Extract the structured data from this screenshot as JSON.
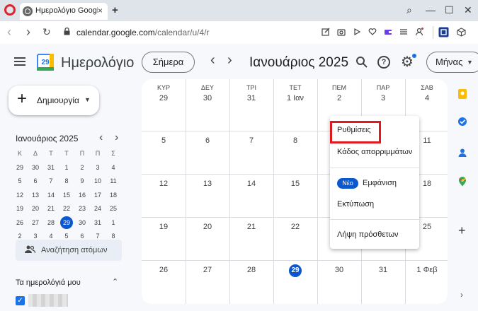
{
  "browser": {
    "tab_title": "Ημερολόγιο Google - Ιαν",
    "tab_close": "×",
    "new_tab": "+",
    "url_host": "calendar.google.com",
    "url_path": "/calendar/u/4/r",
    "controls": {
      "search": "⌕",
      "minimize": "—",
      "maximize": "☐",
      "close": "✕"
    },
    "nav": {
      "back": "‹",
      "forward": "›",
      "reload": "↻"
    }
  },
  "header": {
    "app_title": "Ημερολόγιο",
    "logo_day": "29",
    "today_button": "Σήμερα",
    "prev": "‹",
    "next": "›",
    "month_title": "Ιανουάριος 2025",
    "help": "?",
    "gear": "⚙",
    "view_button": "Μήνας",
    "view_caret": "▼"
  },
  "sidebar": {
    "create_label": "Δημιουργία",
    "create_plus": "+",
    "create_caret": "▼",
    "mini_title": "Ιανουάριος 2025",
    "mini_prev": "‹",
    "mini_next": "›",
    "weekday_heads": [
      "Κ",
      "Δ",
      "Τ",
      "Τ",
      "Π",
      "Π",
      "Σ"
    ],
    "mini_weeks": [
      [
        "29",
        "30",
        "31",
        "1",
        "2",
        "3",
        "4"
      ],
      [
        "5",
        "6",
        "7",
        "8",
        "9",
        "10",
        "11"
      ],
      [
        "12",
        "13",
        "14",
        "15",
        "16",
        "17",
        "18"
      ],
      [
        "19",
        "20",
        "21",
        "22",
        "23",
        "24",
        "25"
      ],
      [
        "26",
        "27",
        "28",
        "29",
        "30",
        "31",
        "1"
      ],
      [
        "2",
        "3",
        "4",
        "5",
        "6",
        "7",
        "8"
      ]
    ],
    "people_search": "Αναζήτηση ατόμων",
    "my_calendars": "Τα ημερολόγιά μου",
    "my_calendars_chevron": "⌃",
    "check": "✓"
  },
  "calendar": {
    "day_heads": [
      "ΚΥΡ",
      "ΔΕΥ",
      "ΤΡΙ",
      "ΤΕΤ",
      "ΠΕΜ",
      "ΠΑΡ",
      "ΣΑΒ"
    ],
    "weeks": [
      [
        "29",
        "30",
        "31",
        "1 Ιαν",
        "2",
        "3",
        "4"
      ],
      [
        "5",
        "6",
        "7",
        "8",
        "9",
        "10",
        "11"
      ],
      [
        "12",
        "13",
        "14",
        "15",
        "16",
        "17",
        "18"
      ],
      [
        "19",
        "20",
        "21",
        "22",
        "23",
        "24",
        "25"
      ],
      [
        "26",
        "27",
        "28",
        "29",
        "30",
        "31",
        "1 Φεβ"
      ]
    ]
  },
  "settings_menu": {
    "settings": "Ρυθμίσεις",
    "trash": "Κάδος απορριμμάτων",
    "new_badge": "Νέο",
    "appearance": "Εμφάνιση",
    "print": "Εκτύπωση",
    "get_addons": "Λήψη πρόσθετων"
  },
  "rail": {
    "add": "+",
    "expand": "›"
  },
  "colors": {
    "accent": "#0b57d0",
    "highlight": "#e0191f"
  }
}
